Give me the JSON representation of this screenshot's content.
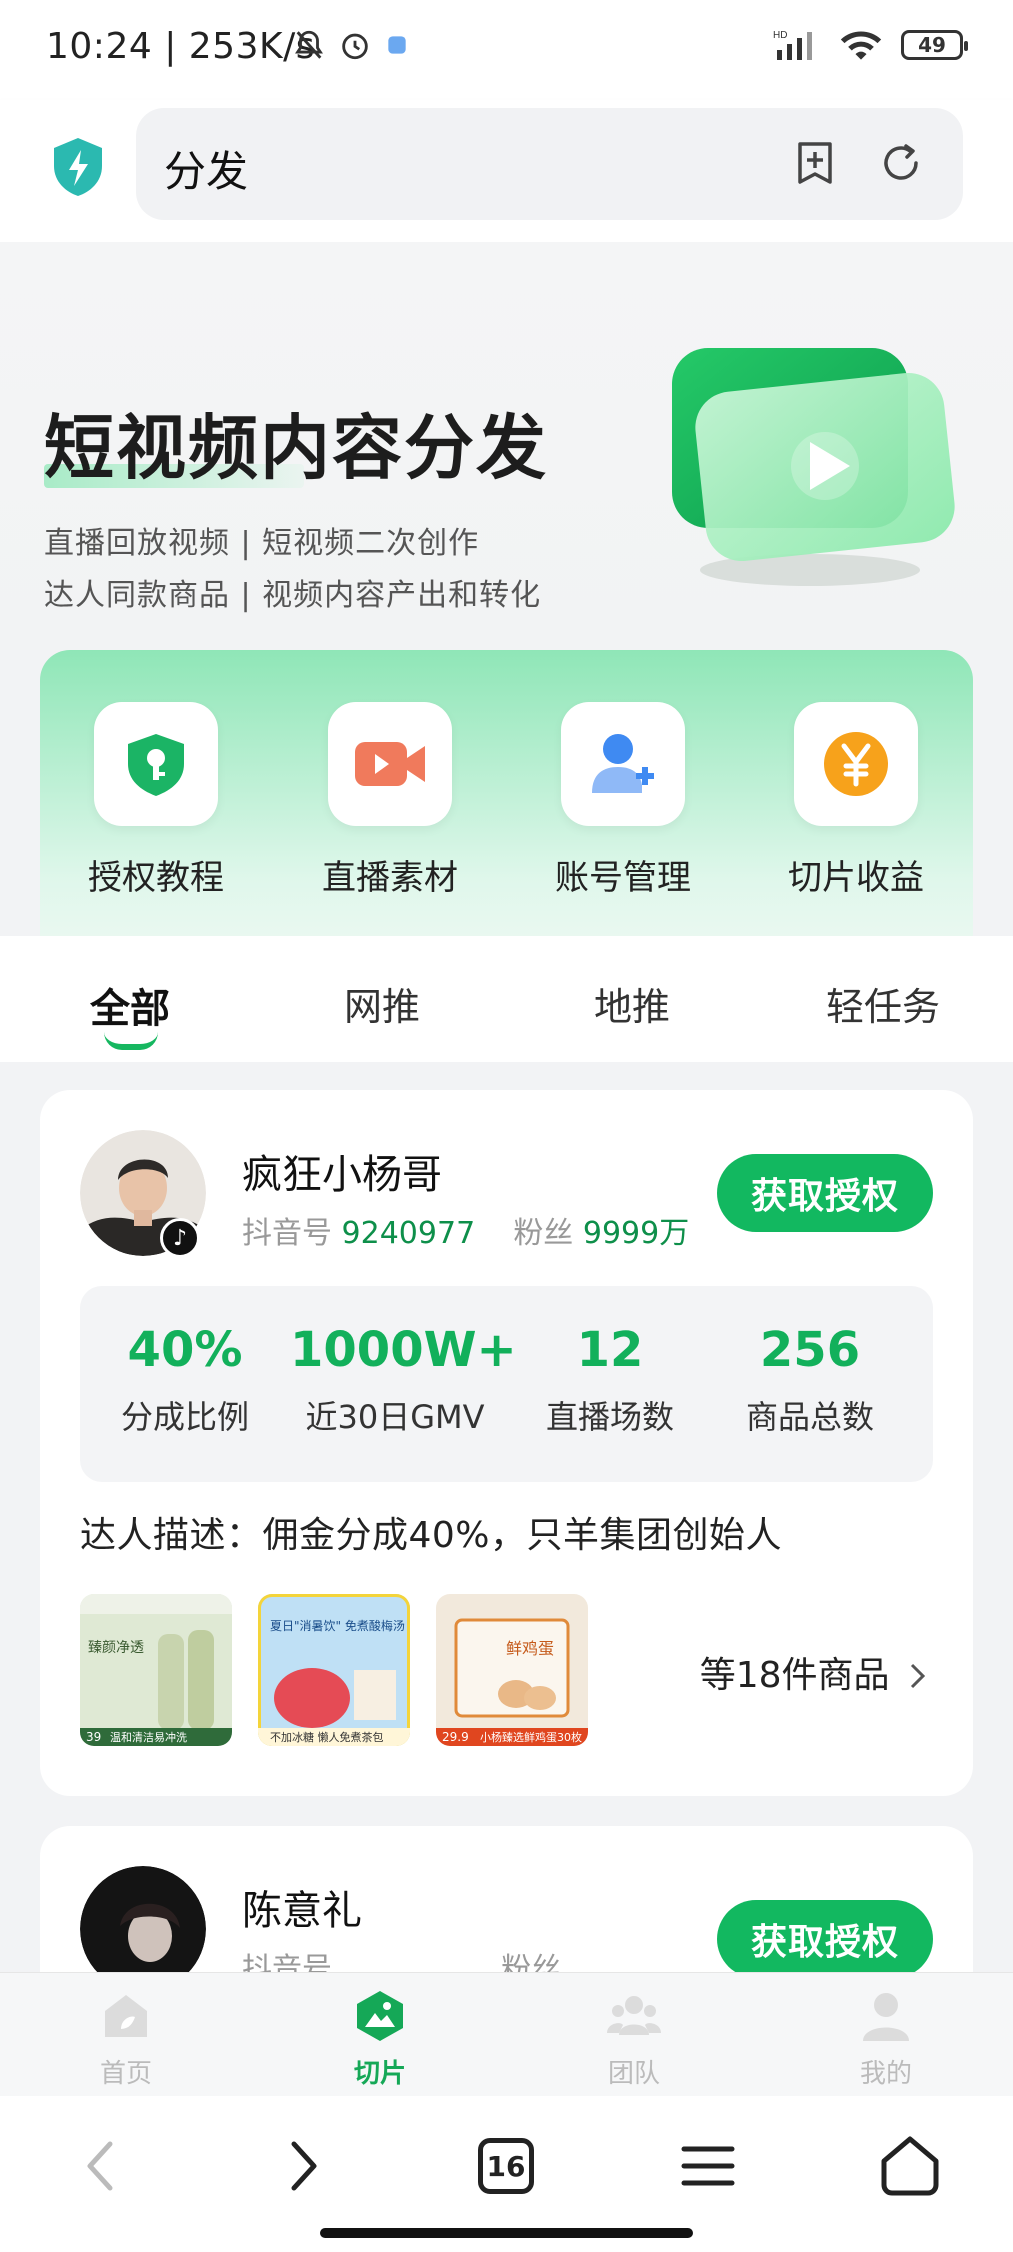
{
  "status": {
    "time": "10:24 | 253K/s",
    "signal": "HD",
    "battery": "49"
  },
  "browser": {
    "url": "分发",
    "tab_count": "16"
  },
  "hero": {
    "title": "短视频内容分发",
    "line1": "直播回放视频  |  短视频二次创作",
    "line2": "达人同款商品  |  视频内容产出和转化"
  },
  "quick": [
    {
      "label": "授权教程",
      "icon": "shield-key-icon"
    },
    {
      "label": "直播素材",
      "icon": "video-camera-icon"
    },
    {
      "label": "账号管理",
      "icon": "add-user-icon"
    },
    {
      "label": "切片收益",
      "icon": "yen-coin-icon"
    }
  ],
  "tabs": [
    "全部",
    "网推",
    "地推",
    "轻任务"
  ],
  "cards": [
    {
      "name": "疯狂小杨哥",
      "id_label": "抖音号",
      "id_value": "9240977",
      "fans_label": "粉丝",
      "fans_value": "9999万",
      "button": "获取授权",
      "stats": [
        {
          "value": "40%",
          "label": "分成比例"
        },
        {
          "value": "1000W+",
          "label": "近30日GMV"
        },
        {
          "value": "12",
          "label": "直播场数"
        },
        {
          "value": "256",
          "label": "商品总数"
        }
      ],
      "desc": "达人描述：佣金分成40%，只羊集团创始人",
      "more": "等18件商品",
      "products": [
        {
          "price": "39",
          "caption": "温和清洁易冲洗",
          "tag": "臻颜净透"
        },
        {
          "price": "",
          "caption": "不加冰糖 懒人免煮茶包",
          "tag": "夏日\"消暑饮\" 免煮酸梅汤"
        },
        {
          "price": "29.9",
          "caption": "小杨臻选鲜鸡蛋30枚",
          "tag": "鲜鸡蛋"
        }
      ]
    },
    {
      "name": "陈意礼",
      "id_label": "抖音号",
      "fans_label": "粉丝",
      "button": "获取授权"
    }
  ],
  "app_nav": [
    {
      "label": "首页",
      "icon": "home-icon"
    },
    {
      "label": "切片",
      "icon": "slice-icon"
    },
    {
      "label": "团队",
      "icon": "team-icon"
    },
    {
      "label": "我的",
      "icon": "profile-icon"
    }
  ]
}
